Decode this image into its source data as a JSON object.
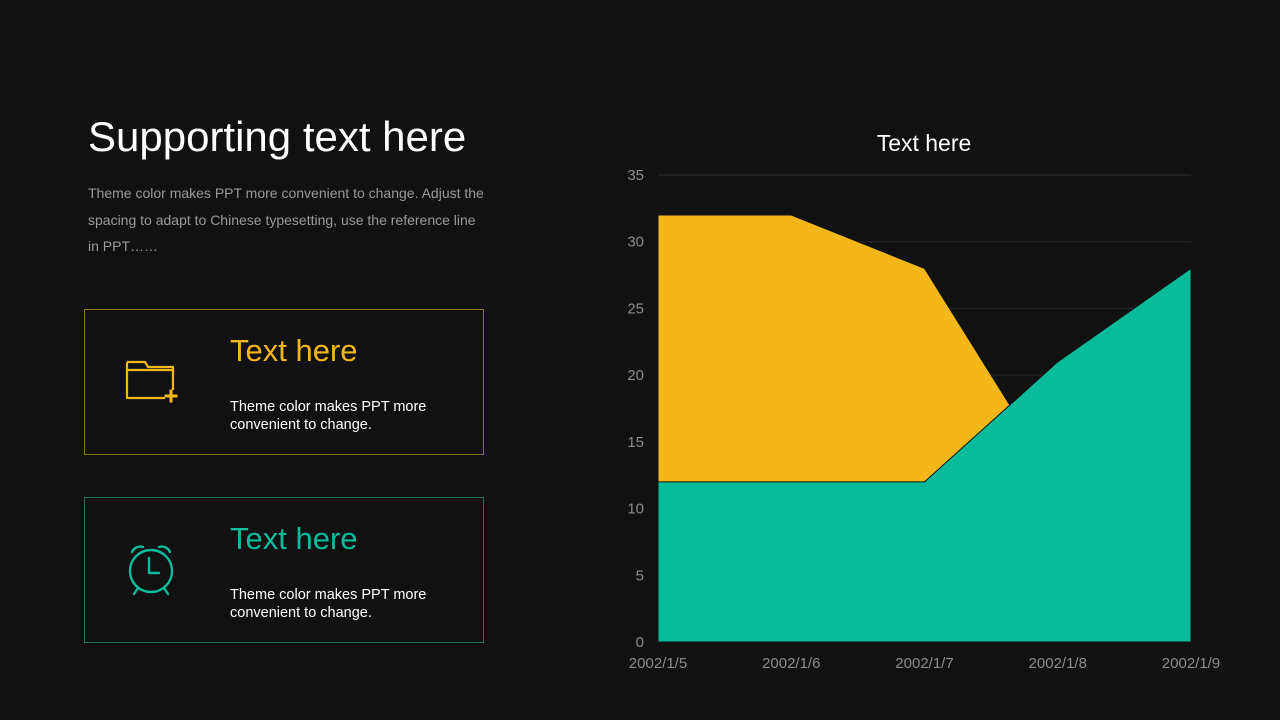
{
  "headline": "Supporting text here",
  "description": "Theme color makes PPT more convenient to change. Adjust the spacing to adapt to Chinese typesetting, use the reference line in PPT……",
  "cards": [
    {
      "title": "Text here",
      "text": "Theme color makes PPT more convenient to change.",
      "icon": "folder-plus-icon",
      "color": "#f4b719"
    },
    {
      "title": "Text here",
      "text": "Theme color makes PPT more convenient to change.",
      "icon": "alarm-clock-icon",
      "color": "#08bc9b"
    }
  ],
  "chart_data": {
    "type": "area",
    "title": "Text here",
    "categories": [
      "2002/1/5",
      "2002/1/6",
      "2002/1/7",
      "2002/1/8",
      "2002/1/9"
    ],
    "series": [
      {
        "values": [
          12,
          12,
          12,
          21,
          28
        ],
        "color": "#08bc9b"
      },
      {
        "values": [
          32,
          32,
          28,
          12,
          12
        ],
        "color": "#f4b719"
      }
    ],
    "ylim": [
      0,
      35
    ],
    "yticks": [
      0,
      5,
      10,
      15,
      20,
      25,
      30,
      35
    ],
    "grid": true,
    "legend": "none"
  }
}
